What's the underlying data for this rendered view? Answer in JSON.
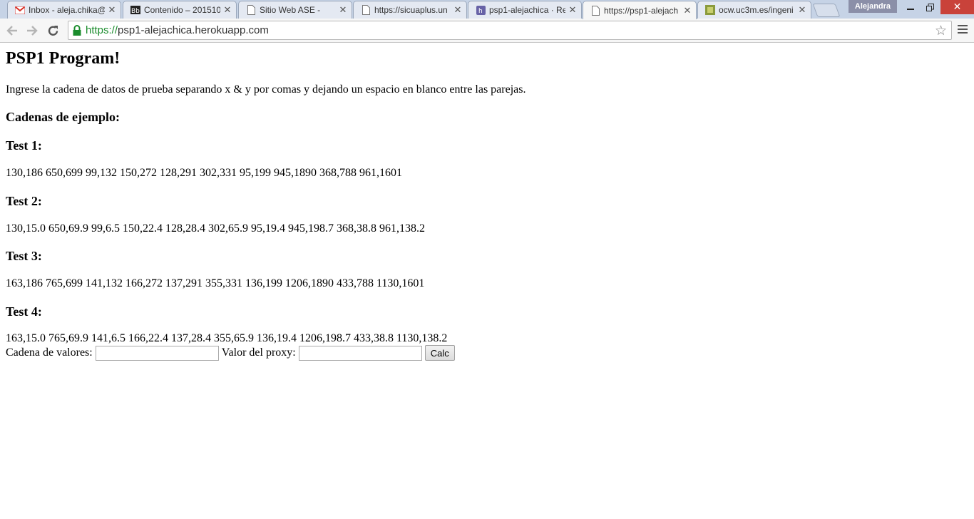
{
  "browser": {
    "tabs": [
      {
        "title": "Inbox - aleja.chika@",
        "icon": "gmail-icon",
        "active": false
      },
      {
        "title": "Contenido – 201510",
        "icon": "blackboard-icon",
        "active": false
      },
      {
        "title": "Sitio Web ASE -",
        "icon": "page-icon",
        "active": false
      },
      {
        "title": "https://sicuaplus.un",
        "icon": "page-icon",
        "active": false
      },
      {
        "title": "psp1-alejachica · Re",
        "icon": "heroku-icon",
        "active": false
      },
      {
        "title": "https://psp1-alejach",
        "icon": "page-icon",
        "active": true
      },
      {
        "title": "ocw.uc3m.es/ingeni",
        "icon": "site-icon",
        "active": false
      }
    ],
    "profile_name": "Alejandra",
    "address": {
      "scheme": "https://",
      "host": "psp1-alejachica.herokuapp.com"
    },
    "colors": {
      "ssl_green": "#1a8c2c",
      "close_red": "#c9423a",
      "tabstrip": "#c6d3e6"
    }
  },
  "page": {
    "title": "PSP1 Program!",
    "instructions": "Ingrese la cadena de datos de prueba separando x & y por comas y dejando un espacio en blanco entre las parejas.",
    "examples_heading": "Cadenas de ejemplo:",
    "tests": [
      {
        "heading": "Test 1:",
        "data": "130,186 650,699 99,132 150,272 128,291 302,331 95,199 945,1890 368,788 961,1601"
      },
      {
        "heading": "Test 2:",
        "data": "130,15.0 650,69.9 99,6.5 150,22.4 128,28.4 302,65.9 95,19.4 945,198.7 368,38.8 961,138.2"
      },
      {
        "heading": "Test 3:",
        "data": "163,186 765,699 141,132 166,272 137,291 355,331 136,199 1206,1890 433,788 1130,1601"
      },
      {
        "heading": "Test 4:",
        "data": "163,15.0 765,69.9 141,6.5 166,22.4 137,28.4 355,65.9 136,19.4 1206,198.7 433,38.8 1130,138.2"
      }
    ],
    "form": {
      "values_label": "Cadena de valores:",
      "values_value": "",
      "proxy_label": "Valor del proxy:",
      "proxy_value": "",
      "submit_label": "Calc"
    }
  }
}
